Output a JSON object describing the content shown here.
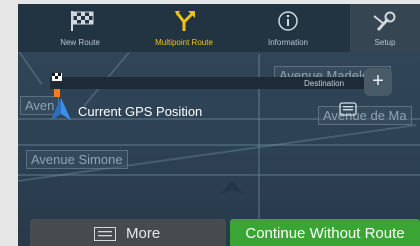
{
  "toolbar": {
    "items": [
      {
        "label": "New Route",
        "icon": "checkered-flag-icon",
        "active": false
      },
      {
        "label": "Multipoint Route",
        "icon": "multipoint-route-icon",
        "active": true
      },
      {
        "label": "Information",
        "icon": "info-icon",
        "active": false
      },
      {
        "label": "Setup",
        "icon": "wrench-icon",
        "active": false
      }
    ]
  },
  "map": {
    "streets": [
      "Avenue Madeleine",
      "Avenue de Ma",
      "Avenue Simone",
      "Aven"
    ]
  },
  "route": {
    "destination_label": "Destination",
    "add_icon": "plus-icon",
    "start_label": "Current GPS Position",
    "start_icon": "gps-arrow-icon",
    "message_icon": "message-icon"
  },
  "buttons": {
    "more_label": "More",
    "more_icon": "list-icon",
    "continue_label": "Continue Without Route"
  },
  "colors": {
    "active": "#f2c21b",
    "continue": "#3aa535",
    "more": "#474b4e"
  }
}
